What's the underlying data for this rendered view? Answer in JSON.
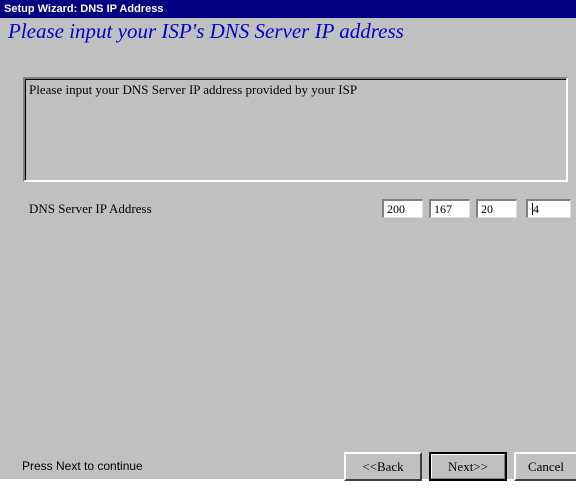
{
  "window": {
    "title": "Setup Wizard: DNS IP Address"
  },
  "header": {
    "title": "Please input your ISP's DNS Server IP address"
  },
  "description": {
    "text": "Please input your DNS Server IP address provided by your ISP"
  },
  "dns_form": {
    "label": "DNS Server IP Address",
    "octets": [
      "200",
      "167",
      "20",
      "4"
    ]
  },
  "footer": {
    "status": "Press Next to continue",
    "back_label": "<<Back",
    "next_label": "Next>>",
    "cancel_label": "Cancel"
  },
  "colors": {
    "title_bar": "#000080",
    "heading_text": "#0000cc",
    "dialog_bg": "#c0c0c0"
  }
}
